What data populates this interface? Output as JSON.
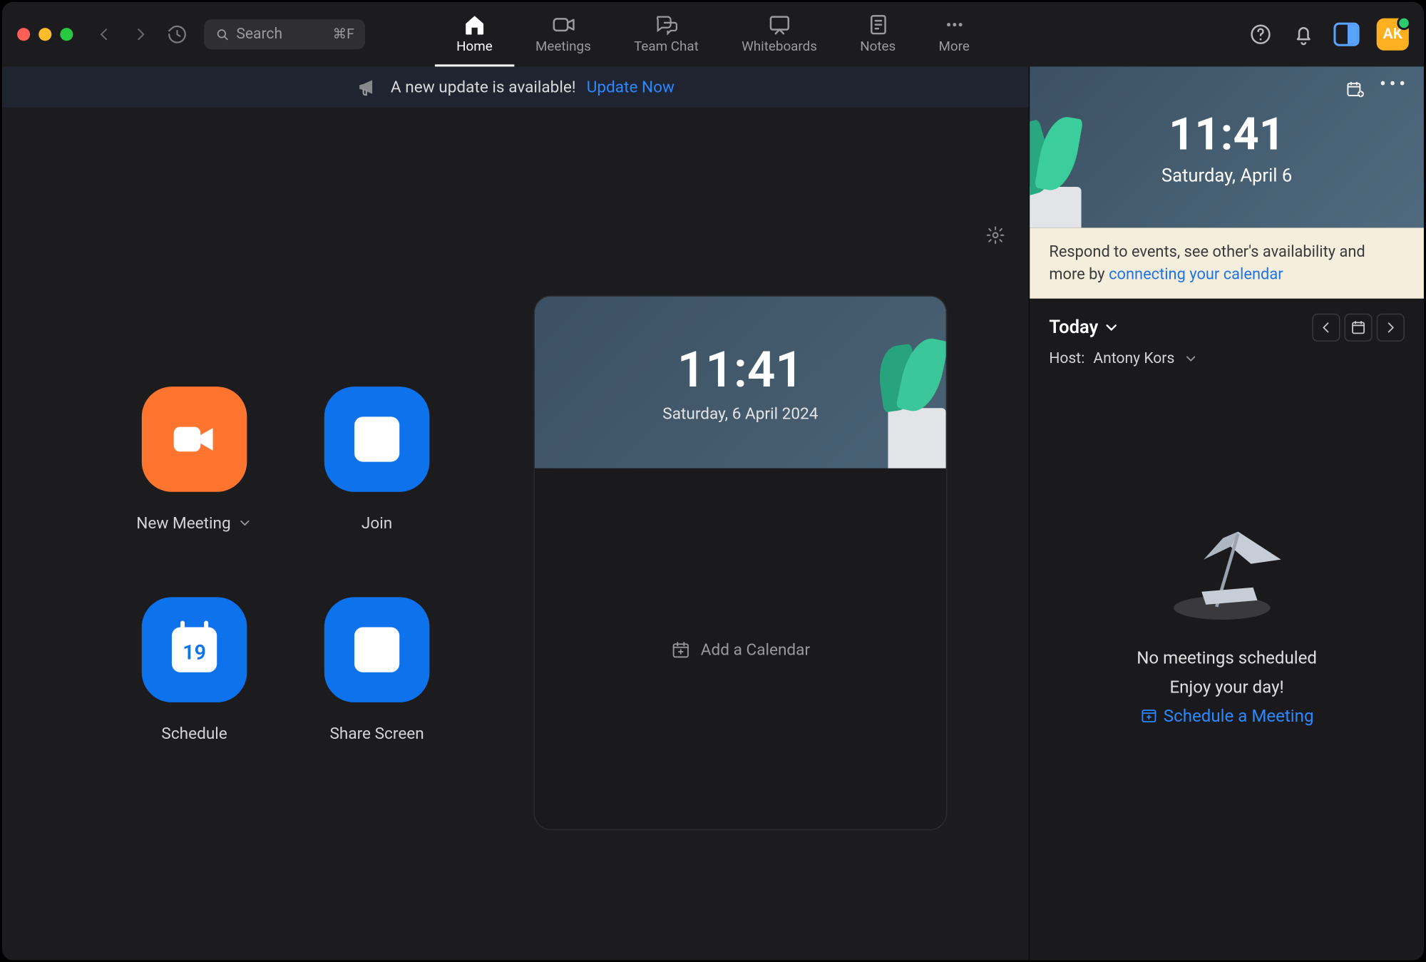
{
  "search": {
    "placeholder": "Search",
    "shortcut": "⌘F"
  },
  "tabs": {
    "home": "Home",
    "meetings": "Meetings",
    "teamchat": "Team Chat",
    "whiteboards": "Whiteboards",
    "notes": "Notes",
    "more": "More"
  },
  "avatar_initials": "AK",
  "banner": {
    "text": "A new update is available!",
    "link": "Update Now"
  },
  "actions": {
    "new_meeting": "New Meeting",
    "join": "Join",
    "schedule": "Schedule",
    "schedule_day": "19",
    "share_screen": "Share Screen"
  },
  "cal_card": {
    "time": "11:41",
    "date": "Saturday, 6 April 2024",
    "add_calendar": "Add a Calendar"
  },
  "sidebar": {
    "time": "11:41",
    "date": "Saturday, April 6",
    "connect_text": "Respond to events, see other's availability and more by ",
    "connect_link": "connecting your calendar",
    "today_label": "Today",
    "host_label": "Host:",
    "host_name": "Antony Kors",
    "empty_line1": "No meetings scheduled",
    "empty_line2": "Enjoy your day!",
    "schedule_link": "Schedule a Meeting"
  }
}
